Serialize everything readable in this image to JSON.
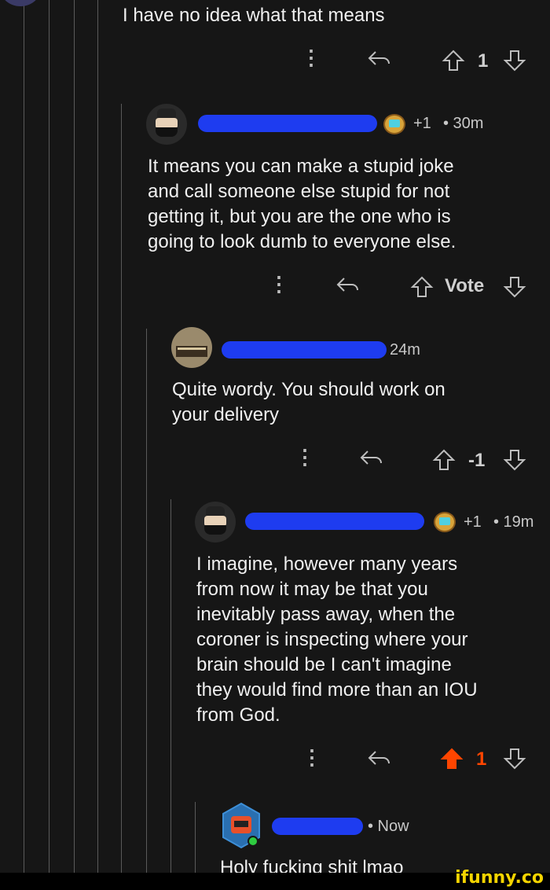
{
  "comments": [
    {
      "text": "I have no idea what that means",
      "votes": "1"
    },
    {
      "karma": "+1",
      "time": "• 30m",
      "text_lines": [
        "It means you can make a stupid joke",
        "and call someone else stupid for not",
        "getting it, but you are the one who is",
        "going to look dumb to everyone else."
      ],
      "votes": "Vote"
    },
    {
      "time": "24m",
      "text_lines": [
        "Quite wordy. You should work on",
        "your delivery"
      ],
      "votes": "-1"
    },
    {
      "karma": "+1",
      "time": "• 19m",
      "text_lines": [
        "I imagine, however many years",
        "from now it may be that you",
        "inevitably pass away, when the",
        "coroner is inspecting where your",
        "brain should be I can't imagine",
        "they would find more than an IOU",
        "from God."
      ],
      "votes": "1"
    },
    {
      "time": "• Now",
      "text": "Holy fucking shit lmao"
    }
  ],
  "watermark": "ifunny.co",
  "colors": {
    "upvote_active": "#ff4500",
    "redaction": "#1e3cf0",
    "background": "#161616"
  }
}
